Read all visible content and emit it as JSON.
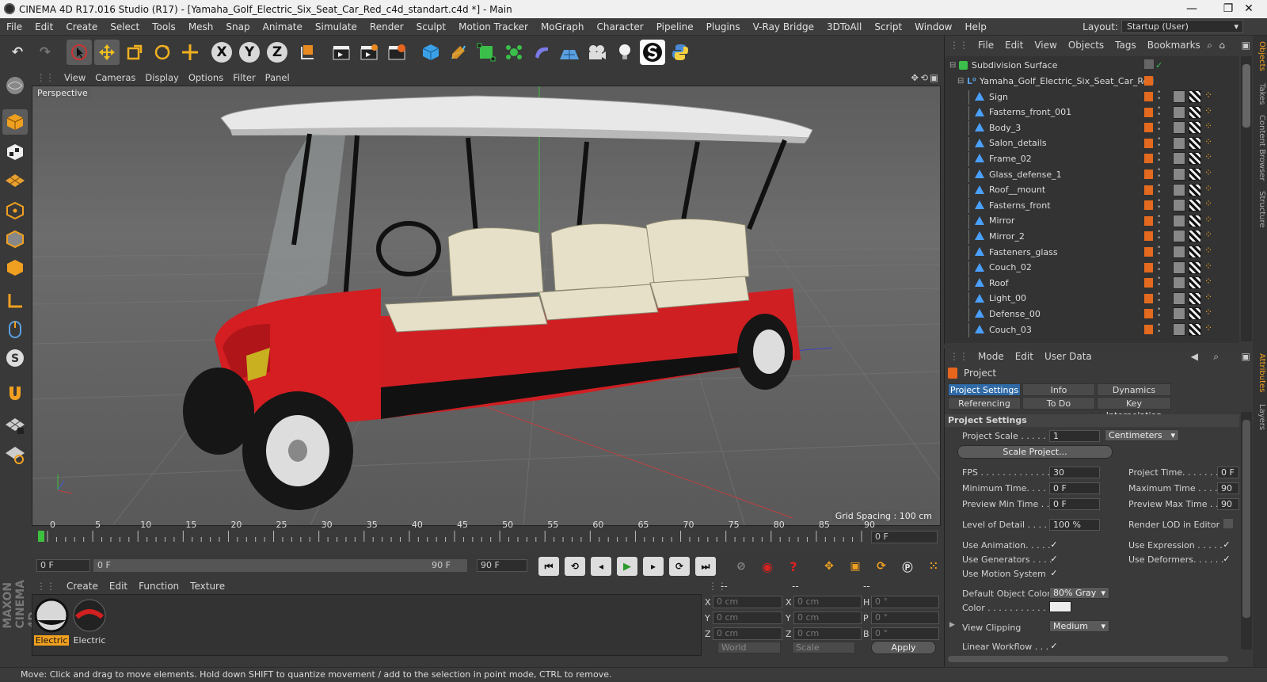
{
  "window": {
    "title": "CINEMA 4D R17.016 Studio (R17) - [Yamaha_Golf_Electric_Six_Seat_Car_Red_c4d_standart.c4d *] - Main",
    "minimize": "—",
    "maximize": "❐",
    "close": "✕"
  },
  "menu": [
    "File",
    "Edit",
    "Create",
    "Select",
    "Tools",
    "Mesh",
    "Snap",
    "Animate",
    "Simulate",
    "Render",
    "Sculpt",
    "Motion Tracker",
    "MoGraph",
    "Character",
    "Pipeline",
    "Plugins",
    "V-Ray Bridge",
    "3DToAll",
    "Script",
    "Window",
    "Help"
  ],
  "layout": {
    "label": "Layout:",
    "value": "Startup (User)"
  },
  "toolbar": {
    "undo": "↶",
    "redo": "↷",
    "x": "X",
    "y": "Y",
    "z": "Z"
  },
  "viewport": {
    "menu": [
      "View",
      "Cameras",
      "Display",
      "Options",
      "Filter",
      "Panel"
    ],
    "label": "Perspective",
    "grid_spacing": "Grid Spacing : 100 cm"
  },
  "timeline": {
    "ticks": [
      "0",
      "5",
      "10",
      "15",
      "20",
      "25",
      "30",
      "35",
      "40",
      "45",
      "50",
      "55",
      "60",
      "65",
      "70",
      "75",
      "80",
      "85",
      "90"
    ],
    "current_frame": "0 F",
    "frame_start": "0 F",
    "slider_start": "0 F",
    "slider_end": "90 F",
    "frame_end": "90 F"
  },
  "material_manager": {
    "menu": [
      "Create",
      "Edit",
      "Function",
      "Texture"
    ],
    "materials": [
      {
        "label": "Electric",
        "selected": true
      },
      {
        "label": "Electric",
        "selected": false
      }
    ]
  },
  "coordinates": {
    "headers": [
      "--",
      "--",
      "--"
    ],
    "rows": [
      {
        "a": "X",
        "av": "0 cm",
        "b": "X",
        "bv": "0 cm",
        "c": "H",
        "cv": "0 °"
      },
      {
        "a": "Y",
        "av": "0 cm",
        "b": "Y",
        "bv": "0 cm",
        "c": "P",
        "cv": "0 °"
      },
      {
        "a": "Z",
        "av": "0 cm",
        "b": "Z",
        "bv": "0 cm",
        "c": "B",
        "cv": "0 °"
      }
    ],
    "mode": "World",
    "scale": "Scale",
    "apply": "Apply"
  },
  "status": "Move: Click and drag to move elements. Hold down SHIFT to quantize movement / add to the selection in point mode, CTRL to remove.",
  "object_manager": {
    "menu": [
      "File",
      "Edit",
      "View",
      "Objects",
      "Tags",
      "Bookmarks"
    ],
    "root": "Subdivision Surface",
    "group": "Yamaha_Golf_Electric_Six_Seat_Car_Red",
    "objects": [
      "Sign",
      "Fasterns_front_001",
      "Body_3",
      "Salon_details",
      "Frame_02",
      "Glass_defense_1",
      "Roof__mount",
      "Fasterns_front",
      "Mirror",
      "Mirror_2",
      "Fasteners_glass",
      "Couch_02",
      "Roof",
      "Light_00",
      "Defense_00",
      "Couch_03"
    ]
  },
  "attributes": {
    "menu": [
      "Mode",
      "Edit",
      "User Data"
    ],
    "title": "Project",
    "tabs": [
      "Project Settings",
      "Info",
      "Dynamics",
      "Referencing",
      "To Do",
      "Key Interpolation"
    ],
    "section": "Project Settings",
    "project_scale_label": "Project Scale . . . . . .",
    "project_scale_value": "1",
    "project_scale_unit": "Centimeters",
    "scale_project_btn": "Scale Project...",
    "fps_label": "FPS . . . . . . . . . . . . . .",
    "fps_value": "30",
    "project_time_label": "Project Time. . . . . . . .",
    "project_time_value": "0 F",
    "min_time_label": "Minimum Time. . . . .",
    "min_time_value": "0 F",
    "max_time_label": "Maximum Time . . . . .",
    "max_time_value": "90",
    "preview_min_label": "Preview Min Time . .",
    "preview_min_value": "0 F",
    "preview_max_label": "Preview Max Time . . .",
    "preview_max_value": "90",
    "lod_label": "Level of Detail . . . . .",
    "lod_value": "100 %",
    "render_lod_label": "Render LOD in Editor",
    "use_animation_label": "Use Animation. . . . .",
    "use_expression_label": "Use Expression . . . . .",
    "use_generators_label": "Use Generators . . . .",
    "use_deformers_label": "Use Deformers. . . . . .",
    "use_motion_label": "Use Motion System",
    "default_color_label": "Default Object Color",
    "default_color_value": "80% Gray",
    "color_label": "Color . . . . . . . . . . .",
    "view_clipping_label": "View Clipping",
    "view_clipping_value": "Medium",
    "linear_workflow_label": "Linear Workflow . . .",
    "check": "✓"
  },
  "side_tabs": [
    "Objects",
    "Takes",
    "Content Browser",
    "Structure",
    "Attributes",
    "Layers"
  ],
  "brand": "MAXON CINEMA 4D"
}
